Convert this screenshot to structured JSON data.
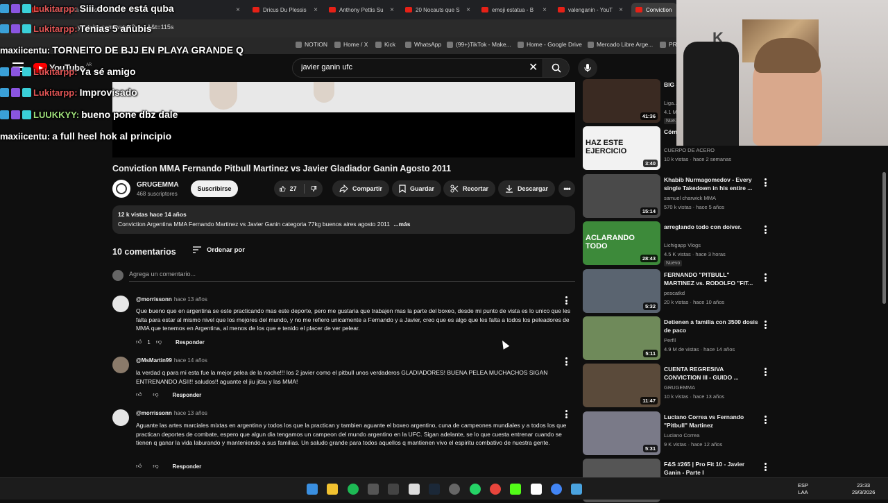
{
  "browser": {
    "tabs": [
      {
        "label": "Siii donde está quba del canal -",
        "active": false
      },
      {
        "label": "Dricus Du Plessis",
        "active": false
      },
      {
        "label": "Anthony Pettis Su",
        "active": false
      },
      {
        "label": "20 Nocauts que S",
        "active": false
      },
      {
        "label": "emoji estatua - B",
        "active": false
      },
      {
        "label": "valenganin - YouT",
        "active": false
      },
      {
        "label": "Conviction",
        "active": true
      }
    ],
    "url": "youtube.com/watch?v=...A&t=115s",
    "bookmarks": [
      "NOTION",
      "Home / X",
      "Kick",
      "WhatsApp",
      "(99+)TikTok - Make...",
      "Home - Google Drive",
      "Mercado Libre Arge...",
      "PR"
    ]
  },
  "header": {
    "logo": "YouTube",
    "region": "AR",
    "search_value": "javier ganin ufc"
  },
  "video": {
    "title": "Conviction MMA Fernando Pitbull Martinez vs Javier Gladiador Ganin Agosto 2011",
    "channel": "GRUGEMMA",
    "subscribers": "468 suscriptores",
    "subscribe_label": "Suscribirse",
    "likes": "27",
    "share_label": "Compartir",
    "save_label": "Guardar",
    "clip_label": "Recortar",
    "download_label": "Descargar",
    "description_meta": "12 k vistas  hace 14 años",
    "description_text": "Conviction Argentina MMA Fernando Martinez vs Javier Ganin categoria 77kg buenos aires agosto 2011",
    "more_label": "...más"
  },
  "comments": {
    "count_label": "10 comentarios",
    "sort_label": "Ordenar por",
    "add_placeholder": "Agrega un comentario...",
    "reply_label": "Responder",
    "items": [
      {
        "author": "@morrissonn",
        "time": "hace 13 años",
        "text": "Que bueno que en argentina se este practicando mas este deporte, pero me gustaria que trabajen mas la parte del boxeo, desde mi punto de vista es lo unico que les falta para estar al mismo nivel que los mejores del mundo, y no me refiero unicamente a Fernando y a Javier, creo que es algo que les falta a todos los peleadores de MMA que tenemos en Argentina, al menos de los que e tenido el placer de ver pelear.",
        "likes": "1"
      },
      {
        "author": "@MsMartin99",
        "time": "hace 14 años",
        "text": "la verdad q para mi esta fue la mejor pelea de la noche!!! los 2 javier como  el pitbull unos verdaderos GLADIADORES! BUENA PELEA MUCHACHOS SIGAN ENTRENANDO ASII!! saludos!! aguante el jiu jitsu y las MMA!",
        "likes": ""
      },
      {
        "author": "@morrissonn",
        "time": "hace 13 años",
        "text": "Aguante las artes marciales mixtas en argentina y todos los que la practican y tambien aguante el boxeo argentino, cuna de campeones mundiales y a todos los que practican deportes de combate, espero que algun dia tengamos un campeon del mundo argentino en la UFC. Sigan adelante, se lo que cuesta entrenar cuando se tienen q ganar la vida laburando y manteniendo a sus familias. Un saludo grande para todos aquellos q mantienen vivo el espiritu combativo de nuestra gente.",
        "likes": ""
      }
    ]
  },
  "related": [
    {
      "title": "BIG SOUL #LIGA...",
      "channel": "Liga...",
      "meta": "4.1 M...",
      "badge": "Nue...",
      "duration": "41:36",
      "color": "#3a2a22"
    },
    {
      "title": "Cómo equi...",
      "channel": "CUERPO DE ACERO",
      "meta": "10 k vistas · hace 2 semanas",
      "badge": "",
      "duration": "3:40",
      "color": "#f2f2f2",
      "thumb_text": "HAZ ESTE EJERCICIO"
    },
    {
      "title": "Khabib Nurmagomedov - Every single Takedown in his entire ...",
      "channel": "samuel charwick MMA",
      "meta": "570 k vistas · hace 5 años",
      "badge": "",
      "duration": "15:14",
      "color": "#4a4a4a"
    },
    {
      "title": "arreglando todo con doiver.",
      "channel": "Lichigapp Vlogs",
      "meta": "4.5 K vistas · hace 3 horas",
      "badge": "Nuevo",
      "duration": "28:43",
      "color": "#3d8a3a",
      "thumb_text": "ACLARANDO TODO"
    },
    {
      "title": "FERNANDO \"PITBULL\" MARTINEZ vs. RODOLFO \"FIT...",
      "channel": "pescatkd",
      "meta": "20 k vistas · hace 10 años",
      "badge": "",
      "duration": "5:32",
      "color": "#5a6470"
    },
    {
      "title": "Detienen a familia con 3500 dosis de paco",
      "channel": "Perfil",
      "meta": "4.9 M de vistas · hace 14 años",
      "badge": "",
      "duration": "5:11",
      "color": "#6f8a5a"
    },
    {
      "title": "CUENTA REGRESIVA CONVICTION III - GUIDO ...",
      "channel": "GRUGEMMA",
      "meta": "10 k vistas · hace 13 años",
      "badge": "",
      "duration": "11:47",
      "color": "#5a4a3a"
    },
    {
      "title": "Luciano Correa vs Fernando \"Pitbull\" Martinez",
      "channel": "Luciano Correa",
      "meta": "9 K vistas · hace 12 años",
      "badge": "",
      "duration": "5:31",
      "color": "#7a7a88"
    },
    {
      "title": "F&S #265 | Pro Fit 10 - Javier Ganin - Parte I",
      "channel": "",
      "meta": "",
      "badge": "",
      "duration": "",
      "color": "#555"
    }
  ],
  "chat": [
    {
      "user": "Lukitarpp:",
      "msg": "Siii donde está quba",
      "color": "#e05555",
      "badges": 3
    },
    {
      "user": "Lukitarpp:",
      "msg": "Tenias 5 añubis",
      "color": "#e05555",
      "badges": 3
    },
    {
      "user": "maxiicentu:",
      "msg": "TORNEITO DE BJJ EN PLAYA GRANDE Q",
      "color": "#ffffff",
      "badges": 0
    },
    {
      "user": "Lukitarpp:",
      "msg": "Ya sé amigo",
      "color": "#e05555",
      "badges": 3
    },
    {
      "user": "Lukitarpp:",
      "msg": "Improvisado",
      "color": "#e05555",
      "badges": 3
    },
    {
      "user": "LUUKKYY:",
      "msg": "bueno pone dbz dale",
      "color": "#9fe07a",
      "badges": 3
    },
    {
      "user": "maxiicentu:",
      "msg": "a full heel hok al principio",
      "color": "#ffffff",
      "badges": 0
    }
  ],
  "taskbar": {
    "lang": "ESP\nLAA",
    "time": "23:33",
    "date": "29/3/2026"
  }
}
